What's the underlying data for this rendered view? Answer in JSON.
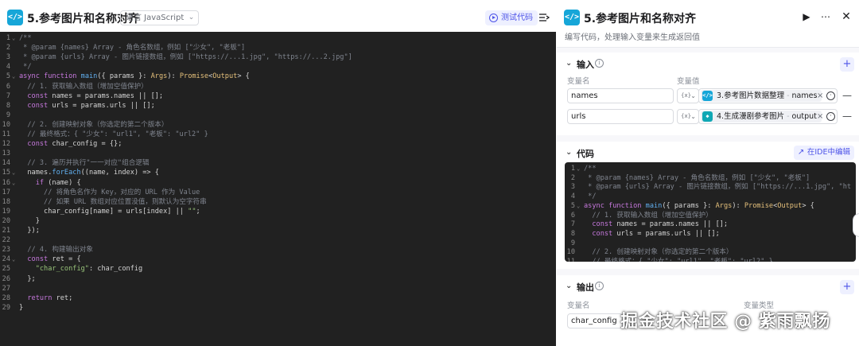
{
  "left_panel": {
    "icon_glyph": "</>",
    "title": "5.参考图片和名称对齐",
    "language_select": "语言 JavaScript",
    "test_button": "测试代码",
    "code_lines": [
      "/**",
      " * @param {names} Array - 角色名数组，例如 [\"少女\", \"老板\"]",
      " * @param {urls} Array - 图片链接数组，例如 [\"https://...1.jpg\", \"https://...2.jpg\"]",
      " */",
      "async function main({ params }: Args): Promise<Output> {",
      "  // 1. 获取输入数组（增加空值保护）",
      "  const names = params.names || [];",
      "  const urls = params.urls || [];",
      "",
      "  // 2. 创建映射对象（你选定的第二个版本）",
      "  // 最终格式：{ \"少女\": \"url1\", \"老板\": \"url2\" }",
      "  const char_config = {};",
      "",
      "  // 3. 遍历并执行\"一一对应\"组合逻辑",
      "  names.forEach((name, index) => {",
      "    if (name) {",
      "      // 将角色名作为 Key，对应的 URL 作为 Value",
      "      // 如果 URL 数组对应位置没值，则默认为空字符串",
      "      char_config[name] = urls[index] || \"\";",
      "    }",
      "  });",
      "",
      "  // 4. 构建输出对象",
      "  const ret = {",
      "    \"char_config\": char_config",
      "  };",
      "",
      "  return ret;",
      "}"
    ]
  },
  "right_panel": {
    "icon_glyph": "</>",
    "title": "5.参考图片和名称对齐",
    "description": "编写代码，处理输入变量来生成返回值",
    "input_section": {
      "title": "输入",
      "col_name": "变量名",
      "col_value": "变量值",
      "type_label": "{x}",
      "rows": [
        {
          "name": "names",
          "source_node": "3.参考图片数据整理",
          "source_var": "names",
          "icon_color": "#16a6d8",
          "icon_glyph": "</>"
        },
        {
          "name": "urls",
          "source_node": "4.生成漫剧参考图片",
          "source_var": "output",
          "icon_color": "#10a8b5",
          "icon_glyph": "◆"
        }
      ]
    },
    "code_section": {
      "title": "代码",
      "ide_button": "在IDE中编辑",
      "preview_lines": [
        "/**",
        " * @param {names} Array - 角色名数组，例如 [\"少女\", \"老板\"]",
        " * @param {urls} Array - 图片链接数组，例如 [\"https://...1.jpg\", \"ht",
        " */",
        "async function main({ params }: Args): Promise<Output> {",
        "  // 1. 获取输入数组（增加空值保护）",
        "  const names = params.names || [];",
        "  const urls = params.urls || [];",
        "",
        "  // 2. 创建映射对象（你选定的第二个版本）",
        "  // 最终格式：{ \"少女\": \"url1\", \"老板\": \"url2\" }"
      ]
    },
    "output_section": {
      "title": "输出",
      "col_name": "变量名",
      "col_type": "变量类型",
      "rows": [
        {
          "name": "char_config"
        }
      ]
    }
  },
  "watermark": "掘金技术社区 @ 紫雨飘扬",
  "colors": {
    "accent": "#4d53e8",
    "code_bg": "#212121",
    "node_icon": "#16a6d8"
  }
}
